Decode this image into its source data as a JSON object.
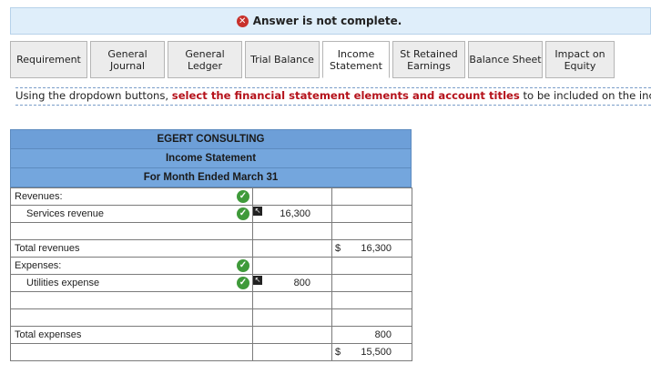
{
  "banner": {
    "message": "Answer is not complete."
  },
  "tabs": [
    {
      "label": "Requirement",
      "width": 85
    },
    {
      "label": "General Journal",
      "width": 82
    },
    {
      "label": "General Ledger",
      "width": 82
    },
    {
      "label": "Trial Balance",
      "width": 82
    },
    {
      "label": "Income Statement",
      "width": 82,
      "active": true
    },
    {
      "label": "St Retained Earnings",
      "width": 80
    },
    {
      "label": "Balance Sheet",
      "width": 82
    },
    {
      "label": "Impact on Equity",
      "width": 82
    }
  ],
  "instructions": {
    "prefix": "Using the dropdown buttons, ",
    "highlight": "select the financial statement elements and account titles",
    "suffix": " to be included on the income statement. The account balances will automatically populate."
  },
  "statement": {
    "company": "EGERT CONSULTING",
    "title": "Income Statement",
    "period": "For Month Ended March 31",
    "rows": [
      {
        "label": "Revenues:",
        "check": true
      },
      {
        "label": "Services revenue",
        "indent": true,
        "check": true,
        "arrow": true,
        "amount": "16,300"
      },
      {
        "label": ""
      },
      {
        "label": "Total revenues",
        "dollar": true,
        "total": "16,300"
      },
      {
        "label": "Expenses:",
        "check": true
      },
      {
        "label": "Utilities expense",
        "indent": true,
        "check": true,
        "arrow": true,
        "amount": "800"
      },
      {
        "label": ""
      },
      {
        "label": ""
      },
      {
        "label": "Total expenses",
        "total": "800"
      },
      {
        "label": "",
        "dollar": true,
        "total": "15,500"
      }
    ]
  }
}
